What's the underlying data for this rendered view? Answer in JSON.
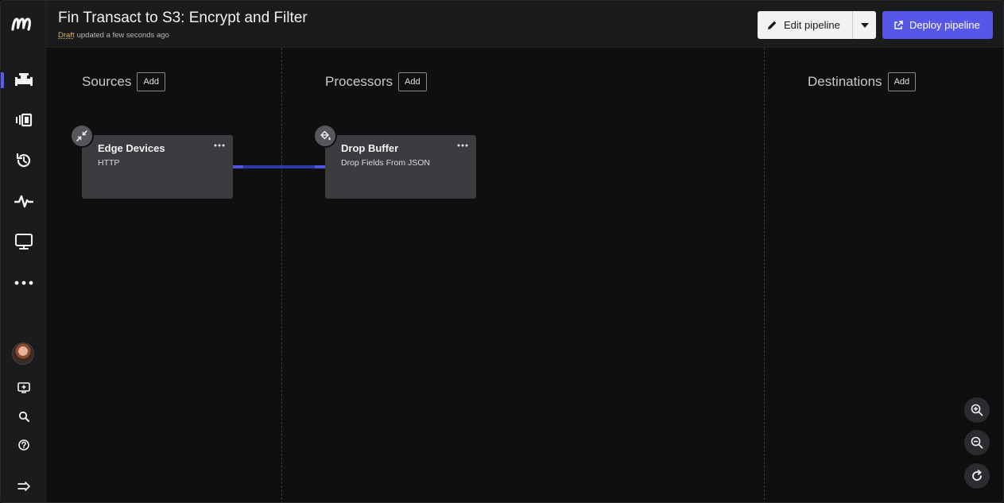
{
  "header": {
    "title": "Fin Transact to S3: Encrypt and Filter",
    "status": "Draft",
    "updated": "updated a few seconds ago",
    "edit_label": "Edit pipeline",
    "deploy_label": "Deploy pipeline"
  },
  "sidebar": {
    "items": [
      {
        "icon": "pipeline-icon",
        "active": true
      },
      {
        "icon": "library-icon"
      },
      {
        "icon": "history-icon"
      },
      {
        "icon": "pulse-icon"
      },
      {
        "icon": "monitor-icon"
      },
      {
        "icon": "more-icon"
      }
    ],
    "footer": [
      "avatar",
      "feedback-icon",
      "search-icon",
      "help-icon",
      "expand-icon"
    ]
  },
  "columns": {
    "sources": {
      "title": "Sources",
      "add_label": "Add"
    },
    "processors": {
      "title": "Processors",
      "add_label": "Add"
    },
    "destinations": {
      "title": "Destinations",
      "add_label": "Add"
    }
  },
  "nodes": {
    "source": {
      "name": "Edge Devices",
      "type": "HTTP",
      "icon": "arrows-in-icon"
    },
    "processor": {
      "name": "Drop Buffer",
      "type": "Drop Fields From JSON",
      "icon": "paint-bucket-icon"
    }
  },
  "colors": {
    "accent": "#5656e8",
    "connector": "#2f3aa8",
    "draft": "#d9b35a"
  }
}
